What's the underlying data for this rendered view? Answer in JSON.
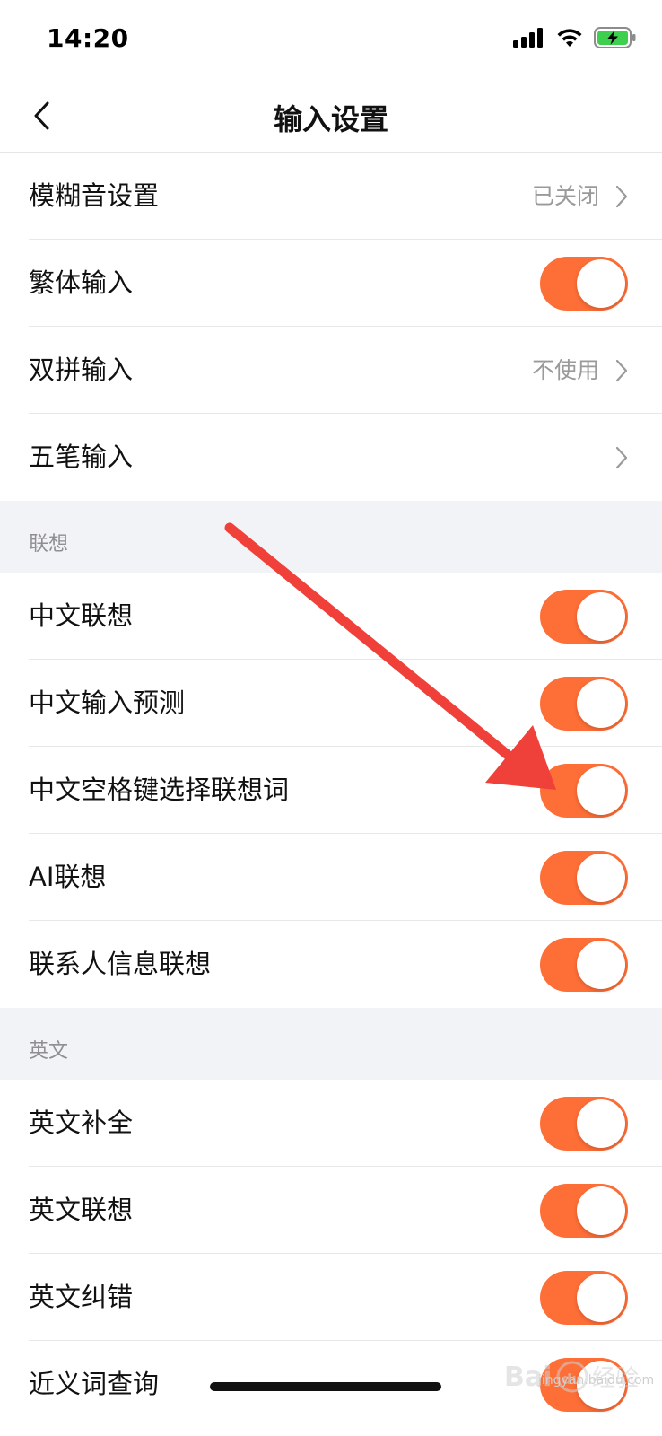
{
  "status_bar": {
    "time": "14:20"
  },
  "nav": {
    "title": "输入设置"
  },
  "groups": [
    {
      "header": "",
      "rows": [
        {
          "label": "模糊音设置",
          "value": "已关闭",
          "type": "link"
        },
        {
          "label": "繁体输入",
          "type": "toggle",
          "on": true
        },
        {
          "label": "双拼输入",
          "value": "不使用",
          "type": "link"
        },
        {
          "label": "五笔输入",
          "value": "",
          "type": "link"
        }
      ]
    },
    {
      "header": "联想",
      "rows": [
        {
          "label": "中文联想",
          "type": "toggle",
          "on": true
        },
        {
          "label": "中文输入预测",
          "type": "toggle",
          "on": true
        },
        {
          "label": "中文空格键选择联想词",
          "type": "toggle",
          "on": true
        },
        {
          "label": "AI联想",
          "type": "toggle",
          "on": true
        },
        {
          "label": "联系人信息联想",
          "type": "toggle",
          "on": true
        }
      ]
    },
    {
      "header": "英文",
      "rows": [
        {
          "label": "英文补全",
          "type": "toggle",
          "on": true
        },
        {
          "label": "英文联想",
          "type": "toggle",
          "on": true
        },
        {
          "label": "英文纠错",
          "type": "toggle",
          "on": true
        },
        {
          "label": "近义词查询",
          "type": "toggle",
          "on": true
        }
      ]
    }
  ],
  "watermark": {
    "text": "jingyan.baidu.com"
  },
  "colors": {
    "toggle_on": "#fe6e37",
    "annotation_arrow": "#f0403a",
    "section_bg": "#f2f3f6"
  }
}
